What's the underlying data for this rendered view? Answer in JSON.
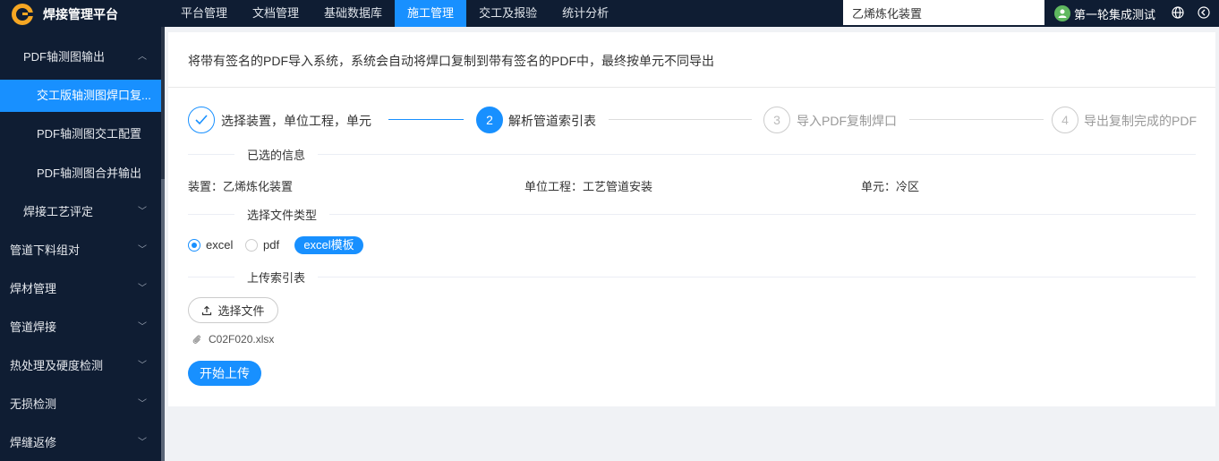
{
  "app": {
    "title": "焊接管理平台"
  },
  "topnav": {
    "items": [
      {
        "label": "平台管理",
        "active": false
      },
      {
        "label": "文档管理",
        "active": false
      },
      {
        "label": "基础数据库",
        "active": false
      },
      {
        "label": "施工管理",
        "active": true
      },
      {
        "label": "交工及报验",
        "active": false
      },
      {
        "label": "统计分析",
        "active": false
      }
    ],
    "search_value": "乙烯炼化装置",
    "user_name": "第一轮集成测试"
  },
  "sidebar": {
    "items": [
      {
        "label": "PDF轴测图输出",
        "expanded": true
      },
      {
        "label": "交工版轴测图焊口复...",
        "active": true
      },
      {
        "label": "PDF轴测图交工配置"
      },
      {
        "label": "PDF轴测图合并输出"
      },
      {
        "label": "焊接工艺评定"
      },
      {
        "label": "管道下料组对"
      },
      {
        "label": "焊材管理"
      },
      {
        "label": "管道焊接"
      },
      {
        "label": "热处理及硬度检测"
      },
      {
        "label": "无损检测"
      },
      {
        "label": "焊缝返修"
      }
    ]
  },
  "main": {
    "description": "将带有签名的PDF导入系统，系统会自动将焊口复制到带有签名的PDF中，最终按单元不同导出",
    "steps": [
      {
        "number": "1",
        "label": "选择装置，单位工程，单元",
        "status": "done"
      },
      {
        "number": "2",
        "label": "解析管道索引表",
        "status": "current"
      },
      {
        "number": "3",
        "label": "导入PDF复制焊口",
        "status": "wait"
      },
      {
        "number": "4",
        "label": "导出复制完成的PDF",
        "status": "wait"
      }
    ],
    "selected_info": {
      "section_title": "已选的信息",
      "device": "装置：乙烯炼化装置",
      "unit_project": "单位工程：工艺管道安装",
      "unit": "单元：冷区"
    },
    "file_type": {
      "section_title": "选择文件类型",
      "options": [
        {
          "label": "excel",
          "checked": true
        },
        {
          "label": "pdf",
          "checked": false
        }
      ],
      "template_button": "excel模板"
    },
    "upload": {
      "section_title": "上传索引表",
      "choose_button": "选择文件",
      "file_name": "C02F020.xlsx",
      "start_button": "开始上传"
    }
  },
  "colors": {
    "primary": "#1890ff",
    "nav_bg": "#0f1d33",
    "page_bg": "#f0f2f5"
  }
}
